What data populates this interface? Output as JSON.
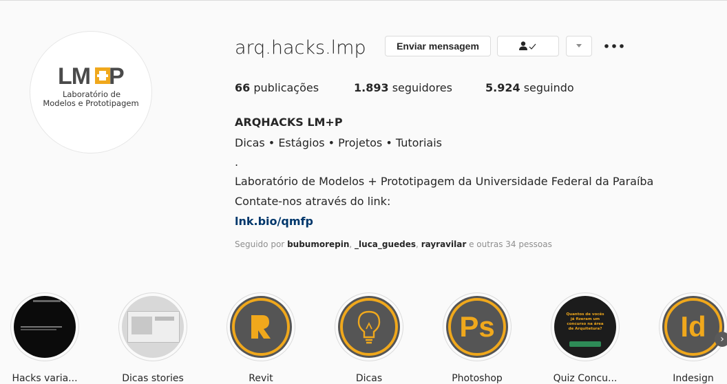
{
  "profile": {
    "username": "arq.hacks.lmp",
    "avatar": {
      "logo_text": "LM+P",
      "line1": "Laboratório de",
      "line2": "Modelos e Prototipagem"
    },
    "buttons": {
      "message": "Enviar mensagem",
      "following_icon": "person-check-icon",
      "dropdown_icon": "chevron-down-icon",
      "more_icon": "more-options-icon"
    },
    "stats": {
      "posts_count": "66",
      "posts_label": "publicações",
      "followers_count": "1.893",
      "followers_label": "seguidores",
      "following_count": "5.924",
      "following_label": "seguindo"
    },
    "bio": {
      "name": "ARQHACKS LM+P",
      "line1": "Dicas • Estágios • Projetos • Tutoriais",
      "line2": ".",
      "line3": "Laboratório de Modelos + Prototipagem da Universidade Federal da Paraíba",
      "line4": "Contate-nos através do link:",
      "link": "lnk.bio/qmfp"
    },
    "followed_by": {
      "prefix": "Seguido por",
      "user1": "bubumorepin",
      "user2": "_luca_guedes",
      "user3": "rayravilar",
      "suffix": "e outras 34 pessoas"
    }
  },
  "highlights": [
    {
      "label": "Hacks varia..."
    },
    {
      "label": "Dicas stories"
    },
    {
      "label": "Revit"
    },
    {
      "label": "Dicas"
    },
    {
      "label": "Photoshop",
      "icon_text": "Ps"
    },
    {
      "label": "Quiz Concu...",
      "quiz_text": "Quantos de vocês já fizeram um concurso na área de Arquitetura?"
    },
    {
      "label": "Indesign",
      "icon_text": "Id"
    }
  ],
  "colors": {
    "accent_orange": "#f0a81c",
    "icon_bg_dark": "#555555",
    "link_blue": "#00376b"
  }
}
